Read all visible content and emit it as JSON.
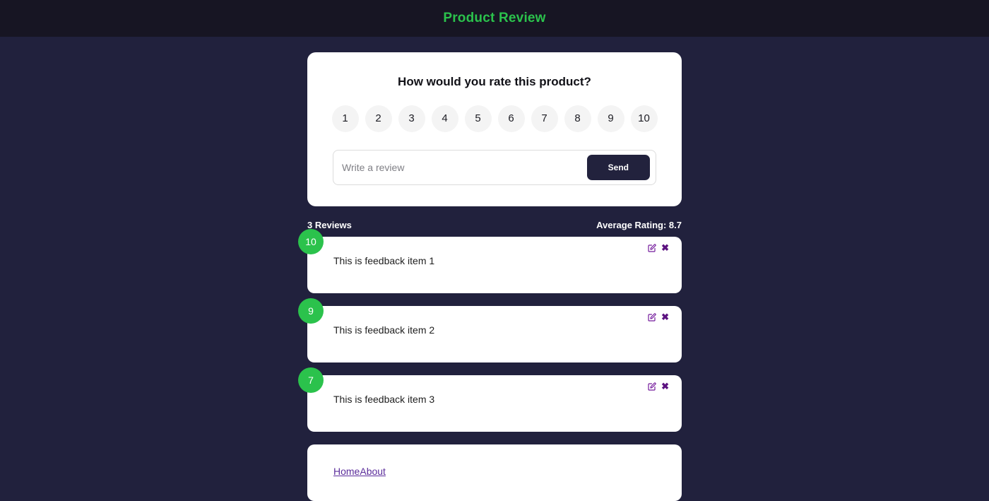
{
  "header": {
    "title": "Product Review"
  },
  "rating_card": {
    "question": "How would you rate this product?",
    "options": [
      "1",
      "2",
      "3",
      "4",
      "5",
      "6",
      "7",
      "8",
      "9",
      "10"
    ],
    "selected": null,
    "input_placeholder": "Write a review",
    "input_value": "",
    "send_label": "Send"
  },
  "stats": {
    "count_label": "3 Reviews",
    "average_label": "Average Rating: 8.7"
  },
  "feedback": {
    "items": [
      {
        "rating": "10",
        "text": "This is feedback item 1",
        "edit_icon": "edit-icon",
        "delete_icon": "close-icon"
      },
      {
        "rating": "9",
        "text": "This is feedback item 2",
        "edit_icon": "edit-icon",
        "delete_icon": "close-icon"
      },
      {
        "rating": "7",
        "text": "This is feedback item 3",
        "edit_icon": "edit-icon",
        "delete_icon": "close-icon"
      }
    ]
  },
  "footer": {
    "links": [
      {
        "label": "Home"
      },
      {
        "label": "About"
      }
    ]
  },
  "colors": {
    "accent_green": "#2bc24c",
    "header_bg": "#171523",
    "page_bg": "#21213d",
    "send_bg": "#22223d",
    "icon_purple": "#741b9c",
    "link_purple": "#5b2d9b"
  }
}
